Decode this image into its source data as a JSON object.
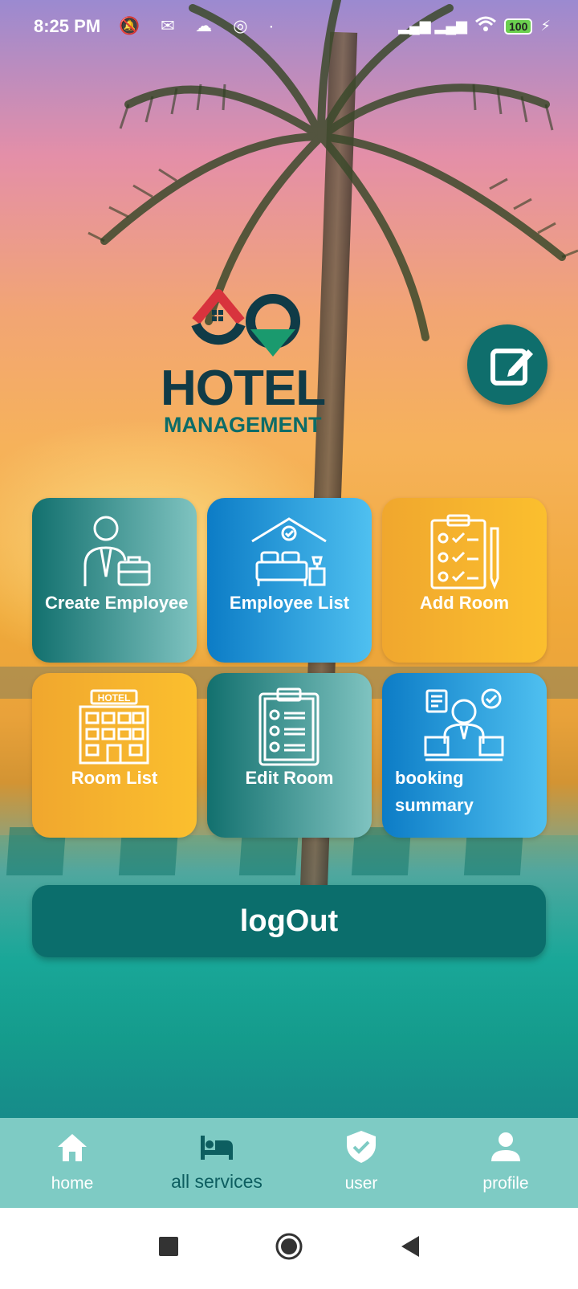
{
  "status_bar": {
    "time": "8:25 PM",
    "notif_icons": "🔕 ✉ ☁ ◎ ·",
    "signal": "▂▄▆ ▂▄▆",
    "battery": "100"
  },
  "logo": {
    "title": "HOTEL",
    "subtitle": "MANAGEMENT"
  },
  "tiles": [
    {
      "label": "Create Employee",
      "icon": "employee-briefcase-icon"
    },
    {
      "label": "Employee List",
      "icon": "hotel-bed-icon"
    },
    {
      "label": "Add Room",
      "icon": "clipboard-checklist-icon"
    },
    {
      "label": "Room List",
      "icon": "hotel-building-icon"
    },
    {
      "label": "Edit Room",
      "icon": "clipboard-list-icon"
    },
    {
      "label": "booking summary",
      "icon": "receptionist-icon"
    }
  ],
  "logout_label": "logOut",
  "bottom_nav": [
    {
      "label": "home",
      "icon": "home-icon"
    },
    {
      "label": "all services",
      "icon": "bed-icon",
      "active": true
    },
    {
      "label": "user",
      "icon": "shield-check-icon"
    },
    {
      "label": "profile",
      "icon": "person-icon"
    }
  ],
  "colors": {
    "primary": "#0b6e6c",
    "nav_bg": "#7ecbc4",
    "nav_active": "#0d5e60"
  }
}
